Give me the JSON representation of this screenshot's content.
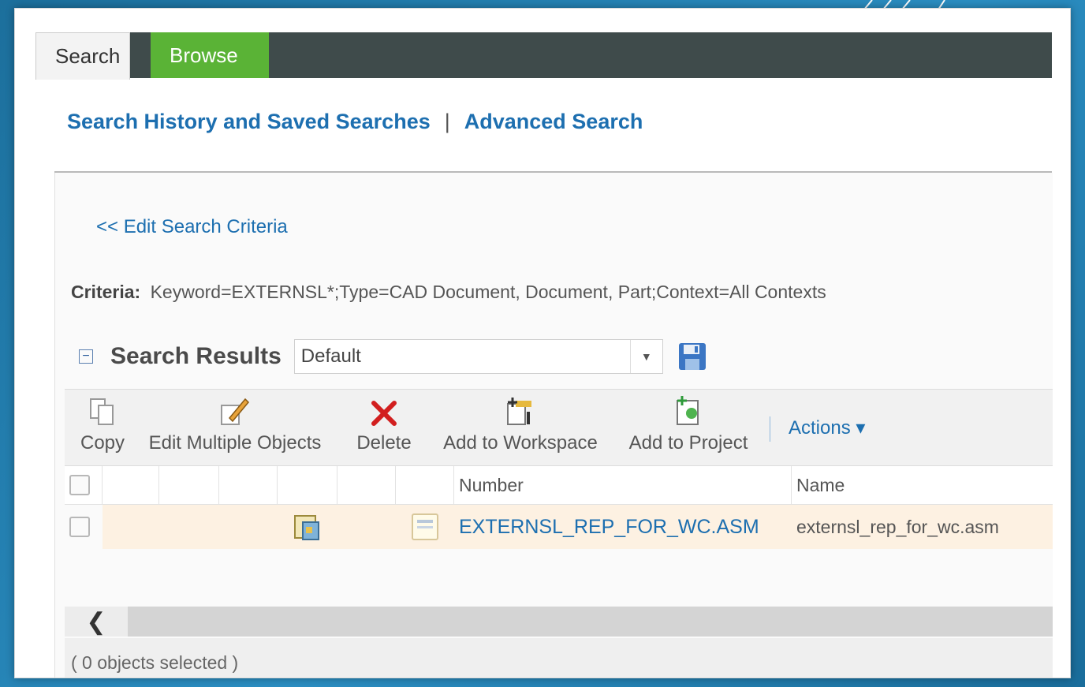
{
  "tabs": [
    {
      "label": "Search",
      "active": true
    },
    {
      "label": "Browse",
      "active": false
    }
  ],
  "links": {
    "history": "Search History and Saved Searches",
    "separator": "|",
    "advanced": "Advanced Search"
  },
  "edit_criteria": "<< Edit Search Criteria",
  "criteria": {
    "label": "Criteria:",
    "text": "Keyword=EXTERNSL*;Type=CAD Document, Document, Part;Context=All Contexts"
  },
  "results": {
    "collapse_symbol": "−",
    "title": "Search Results",
    "view_selected": "Default",
    "dropdown_arrow": "▼"
  },
  "toolbar": {
    "copy": "Copy",
    "edit_multiple": "Edit Multiple Objects",
    "delete": "Delete",
    "add_workspace": "Add to Workspace",
    "add_project": "Add to Project",
    "actions": "Actions ▾"
  },
  "table": {
    "columns": {
      "number": "Number",
      "name": "Name"
    },
    "rows": [
      {
        "number": "EXTERNSL_REP_FOR_WC.ASM",
        "name": "externsl_rep_for_wc.asm"
      }
    ]
  },
  "scroll_left_symbol": "❮",
  "footer": "( 0 objects selected )",
  "colors": {
    "tab_bar": "#3f4b4b",
    "browse_tab": "#5ab336",
    "link": "#1d6fb0",
    "row_highlight": "#fdf1e2",
    "delete_icon": "#d21f1f"
  }
}
